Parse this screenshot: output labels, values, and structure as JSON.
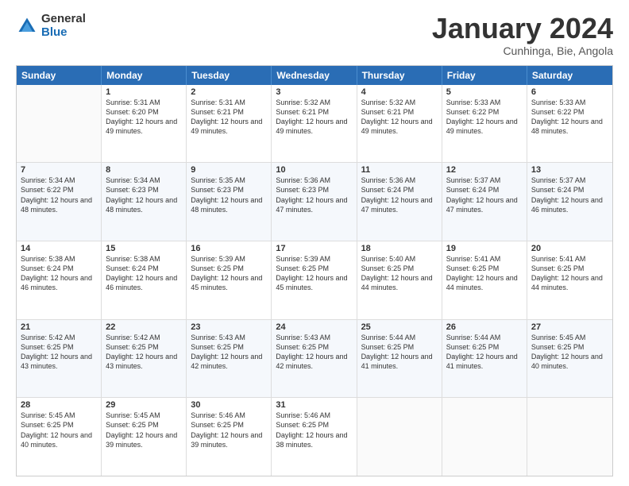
{
  "logo": {
    "general": "General",
    "blue": "Blue"
  },
  "title": {
    "month": "January 2024",
    "location": "Cunhinga, Bie, Angola"
  },
  "header_days": [
    "Sunday",
    "Monday",
    "Tuesday",
    "Wednesday",
    "Thursday",
    "Friday",
    "Saturday"
  ],
  "weeks": [
    [
      {
        "day": "",
        "sunrise": "",
        "sunset": "",
        "daylight": ""
      },
      {
        "day": "1",
        "sunrise": "Sunrise: 5:31 AM",
        "sunset": "Sunset: 6:20 PM",
        "daylight": "Daylight: 12 hours and 49 minutes."
      },
      {
        "day": "2",
        "sunrise": "Sunrise: 5:31 AM",
        "sunset": "Sunset: 6:21 PM",
        "daylight": "Daylight: 12 hours and 49 minutes."
      },
      {
        "day": "3",
        "sunrise": "Sunrise: 5:32 AM",
        "sunset": "Sunset: 6:21 PM",
        "daylight": "Daylight: 12 hours and 49 minutes."
      },
      {
        "day": "4",
        "sunrise": "Sunrise: 5:32 AM",
        "sunset": "Sunset: 6:21 PM",
        "daylight": "Daylight: 12 hours and 49 minutes."
      },
      {
        "day": "5",
        "sunrise": "Sunrise: 5:33 AM",
        "sunset": "Sunset: 6:22 PM",
        "daylight": "Daylight: 12 hours and 49 minutes."
      },
      {
        "day": "6",
        "sunrise": "Sunrise: 5:33 AM",
        "sunset": "Sunset: 6:22 PM",
        "daylight": "Daylight: 12 hours and 48 minutes."
      }
    ],
    [
      {
        "day": "7",
        "sunrise": "Sunrise: 5:34 AM",
        "sunset": "Sunset: 6:22 PM",
        "daylight": "Daylight: 12 hours and 48 minutes."
      },
      {
        "day": "8",
        "sunrise": "Sunrise: 5:34 AM",
        "sunset": "Sunset: 6:23 PM",
        "daylight": "Daylight: 12 hours and 48 minutes."
      },
      {
        "day": "9",
        "sunrise": "Sunrise: 5:35 AM",
        "sunset": "Sunset: 6:23 PM",
        "daylight": "Daylight: 12 hours and 48 minutes."
      },
      {
        "day": "10",
        "sunrise": "Sunrise: 5:36 AM",
        "sunset": "Sunset: 6:23 PM",
        "daylight": "Daylight: 12 hours and 47 minutes."
      },
      {
        "day": "11",
        "sunrise": "Sunrise: 5:36 AM",
        "sunset": "Sunset: 6:24 PM",
        "daylight": "Daylight: 12 hours and 47 minutes."
      },
      {
        "day": "12",
        "sunrise": "Sunrise: 5:37 AM",
        "sunset": "Sunset: 6:24 PM",
        "daylight": "Daylight: 12 hours and 47 minutes."
      },
      {
        "day": "13",
        "sunrise": "Sunrise: 5:37 AM",
        "sunset": "Sunset: 6:24 PM",
        "daylight": "Daylight: 12 hours and 46 minutes."
      }
    ],
    [
      {
        "day": "14",
        "sunrise": "Sunrise: 5:38 AM",
        "sunset": "Sunset: 6:24 PM",
        "daylight": "Daylight: 12 hours and 46 minutes."
      },
      {
        "day": "15",
        "sunrise": "Sunrise: 5:38 AM",
        "sunset": "Sunset: 6:24 PM",
        "daylight": "Daylight: 12 hours and 46 minutes."
      },
      {
        "day": "16",
        "sunrise": "Sunrise: 5:39 AM",
        "sunset": "Sunset: 6:25 PM",
        "daylight": "Daylight: 12 hours and 45 minutes."
      },
      {
        "day": "17",
        "sunrise": "Sunrise: 5:39 AM",
        "sunset": "Sunset: 6:25 PM",
        "daylight": "Daylight: 12 hours and 45 minutes."
      },
      {
        "day": "18",
        "sunrise": "Sunrise: 5:40 AM",
        "sunset": "Sunset: 6:25 PM",
        "daylight": "Daylight: 12 hours and 44 minutes."
      },
      {
        "day": "19",
        "sunrise": "Sunrise: 5:41 AM",
        "sunset": "Sunset: 6:25 PM",
        "daylight": "Daylight: 12 hours and 44 minutes."
      },
      {
        "day": "20",
        "sunrise": "Sunrise: 5:41 AM",
        "sunset": "Sunset: 6:25 PM",
        "daylight": "Daylight: 12 hours and 44 minutes."
      }
    ],
    [
      {
        "day": "21",
        "sunrise": "Sunrise: 5:42 AM",
        "sunset": "Sunset: 6:25 PM",
        "daylight": "Daylight: 12 hours and 43 minutes."
      },
      {
        "day": "22",
        "sunrise": "Sunrise: 5:42 AM",
        "sunset": "Sunset: 6:25 PM",
        "daylight": "Daylight: 12 hours and 43 minutes."
      },
      {
        "day": "23",
        "sunrise": "Sunrise: 5:43 AM",
        "sunset": "Sunset: 6:25 PM",
        "daylight": "Daylight: 12 hours and 42 minutes."
      },
      {
        "day": "24",
        "sunrise": "Sunrise: 5:43 AM",
        "sunset": "Sunset: 6:25 PM",
        "daylight": "Daylight: 12 hours and 42 minutes."
      },
      {
        "day": "25",
        "sunrise": "Sunrise: 5:44 AM",
        "sunset": "Sunset: 6:25 PM",
        "daylight": "Daylight: 12 hours and 41 minutes."
      },
      {
        "day": "26",
        "sunrise": "Sunrise: 5:44 AM",
        "sunset": "Sunset: 6:25 PM",
        "daylight": "Daylight: 12 hours and 41 minutes."
      },
      {
        "day": "27",
        "sunrise": "Sunrise: 5:45 AM",
        "sunset": "Sunset: 6:25 PM",
        "daylight": "Daylight: 12 hours and 40 minutes."
      }
    ],
    [
      {
        "day": "28",
        "sunrise": "Sunrise: 5:45 AM",
        "sunset": "Sunset: 6:25 PM",
        "daylight": "Daylight: 12 hours and 40 minutes."
      },
      {
        "day": "29",
        "sunrise": "Sunrise: 5:45 AM",
        "sunset": "Sunset: 6:25 PM",
        "daylight": "Daylight: 12 hours and 39 minutes."
      },
      {
        "day": "30",
        "sunrise": "Sunrise: 5:46 AM",
        "sunset": "Sunset: 6:25 PM",
        "daylight": "Daylight: 12 hours and 39 minutes."
      },
      {
        "day": "31",
        "sunrise": "Sunrise: 5:46 AM",
        "sunset": "Sunset: 6:25 PM",
        "daylight": "Daylight: 12 hours and 38 minutes."
      },
      {
        "day": "",
        "sunrise": "",
        "sunset": "",
        "daylight": ""
      },
      {
        "day": "",
        "sunrise": "",
        "sunset": "",
        "daylight": ""
      },
      {
        "day": "",
        "sunrise": "",
        "sunset": "",
        "daylight": ""
      }
    ]
  ]
}
